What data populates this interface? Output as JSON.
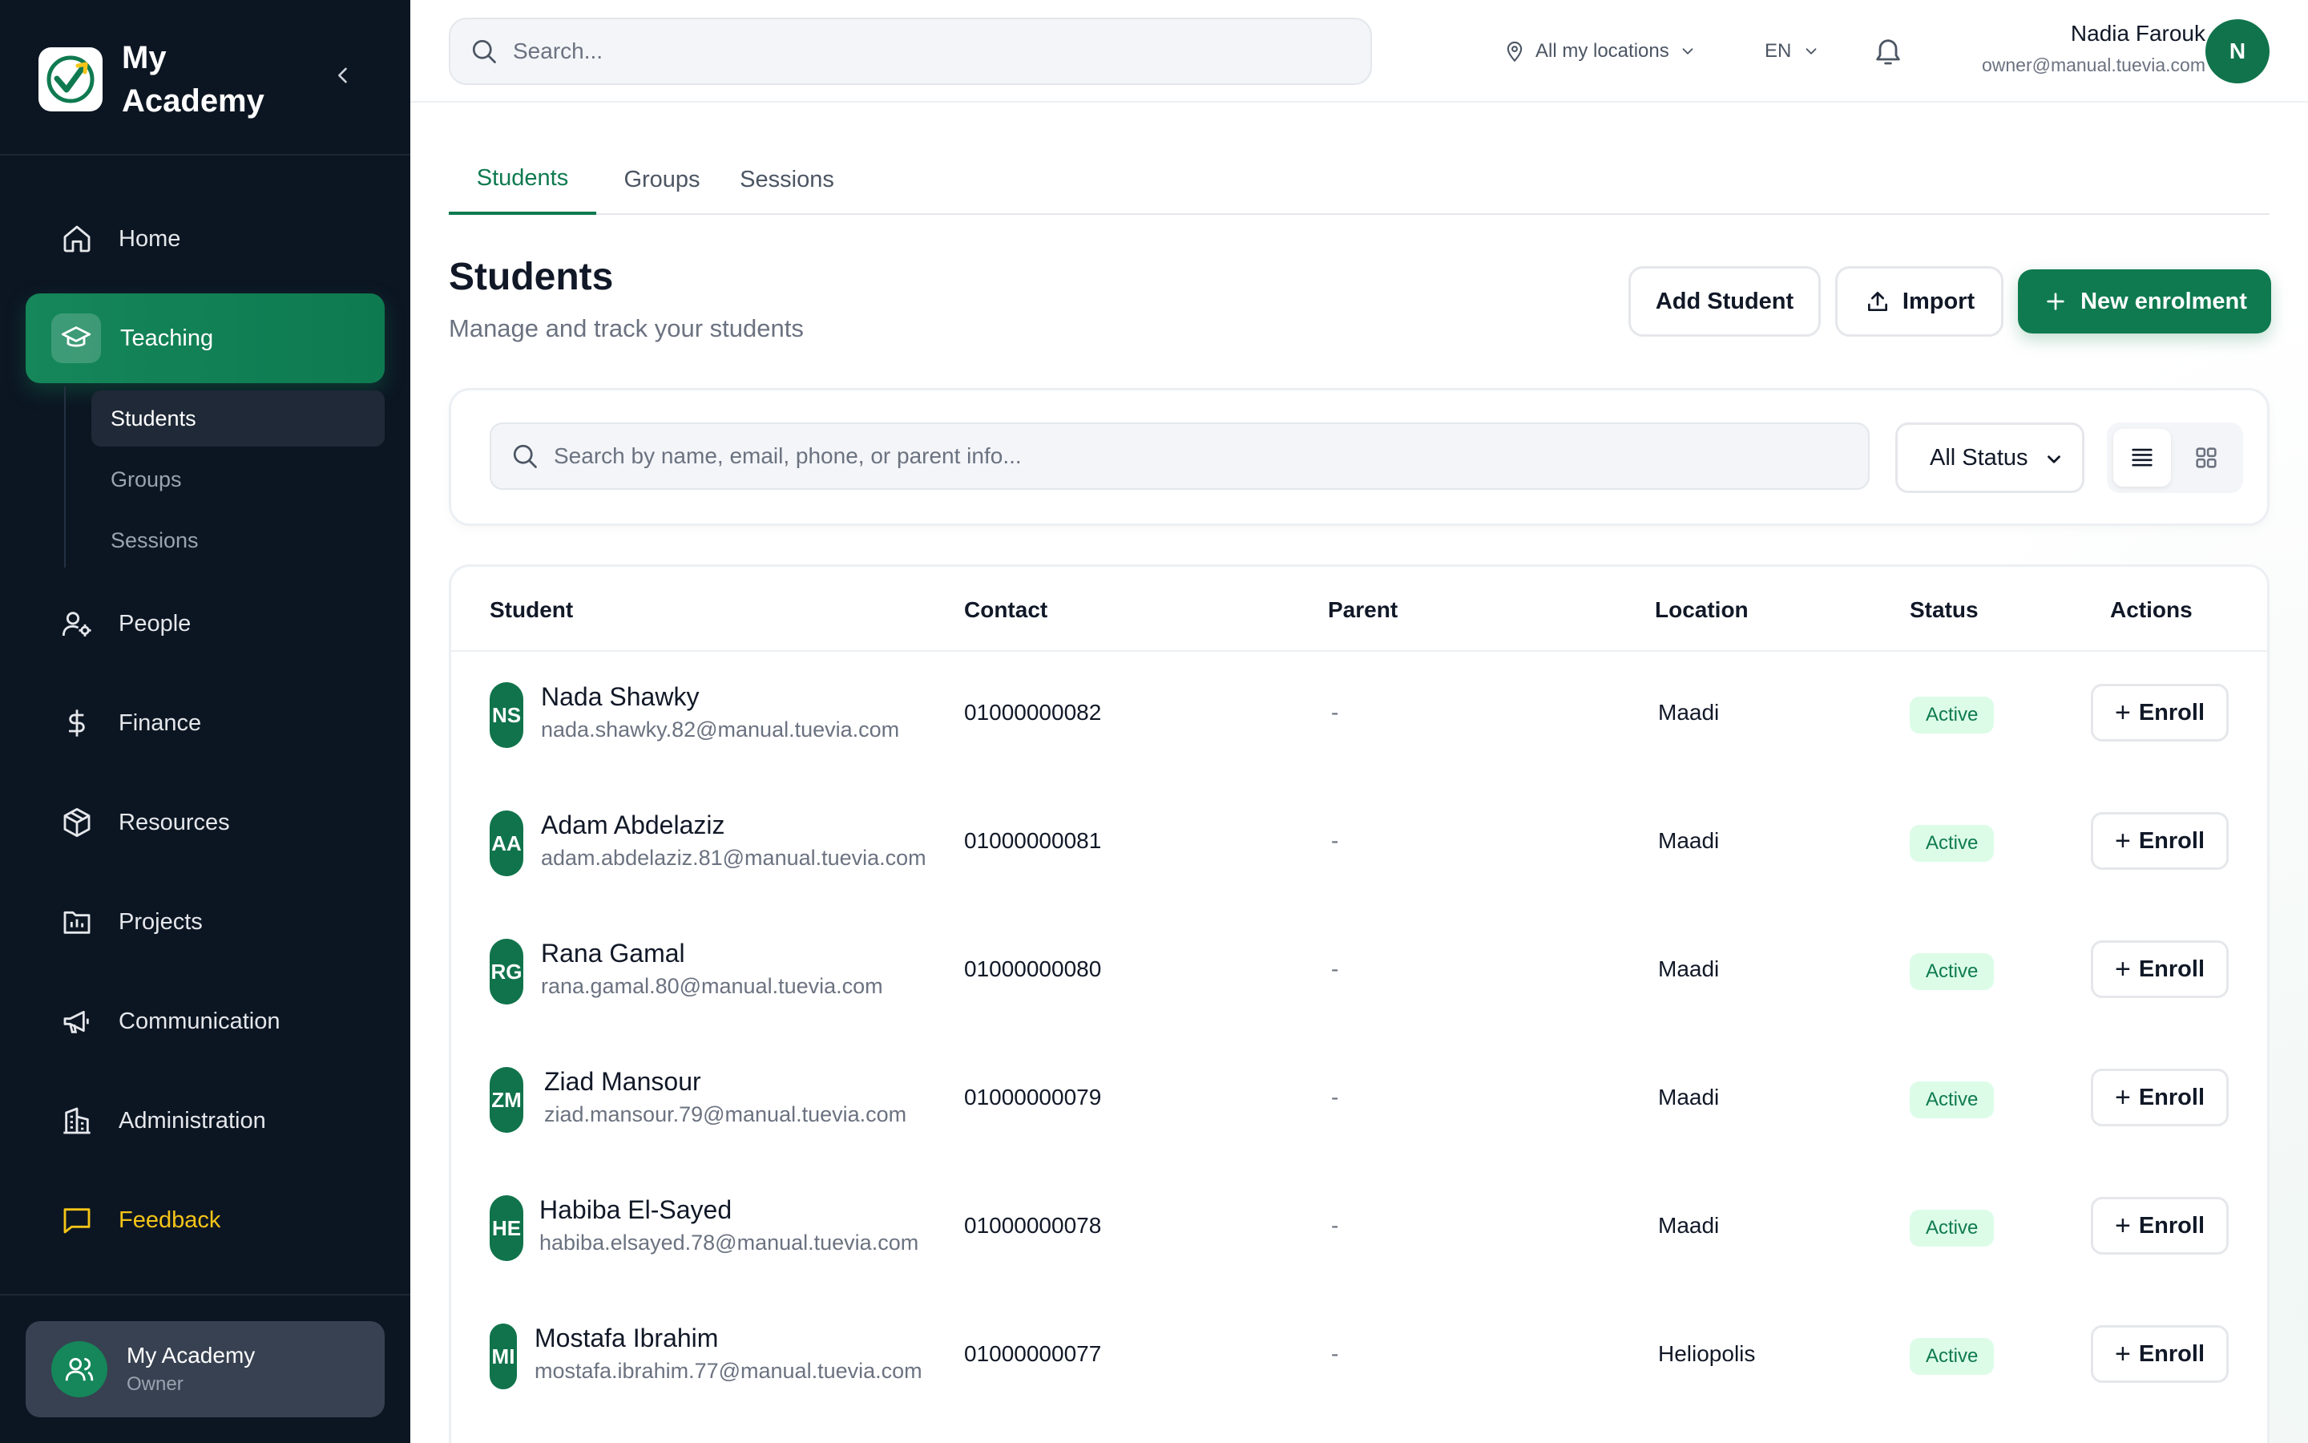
{
  "brand": {
    "name": "My Academy"
  },
  "sidebar": {
    "items": [
      {
        "label": "Home",
        "icon": "home-icon"
      },
      {
        "label": "Teaching",
        "icon": "graduation-cap-icon",
        "active": true
      },
      {
        "label": "People",
        "icon": "user-gear-icon"
      },
      {
        "label": "Finance",
        "icon": "dollar-icon"
      },
      {
        "label": "Resources",
        "icon": "box-icon"
      },
      {
        "label": "Projects",
        "icon": "folder-chart-icon"
      },
      {
        "label": "Communication",
        "icon": "megaphone-icon"
      },
      {
        "label": "Administration",
        "icon": "building-icon"
      },
      {
        "label": "Feedback",
        "icon": "message-square-icon"
      }
    ],
    "subitems": [
      {
        "label": "Students",
        "active": true
      },
      {
        "label": "Groups"
      },
      {
        "label": "Sessions"
      }
    ],
    "account": {
      "name": "My Academy",
      "role": "Owner"
    }
  },
  "topbar": {
    "search_placeholder": "Search...",
    "location": "All my locations",
    "language": "EN",
    "user": {
      "name": "Nadia Farouk",
      "email": "owner@manual.tuevia.com",
      "initial": "N"
    }
  },
  "tabs": [
    {
      "label": "Students",
      "active": true
    },
    {
      "label": "Groups"
    },
    {
      "label": "Sessions"
    }
  ],
  "page": {
    "title": "Students",
    "subtitle": "Manage and track your students",
    "add_student": "Add Student",
    "import": "Import",
    "new_enrolment": "New enrolment"
  },
  "filters": {
    "search_placeholder": "Search by name, email, phone, or parent info...",
    "status": "All Status"
  },
  "table": {
    "columns": {
      "student": "Student",
      "contact": "Contact",
      "parent": "Parent",
      "location": "Location",
      "status": "Status",
      "actions": "Actions"
    },
    "enroll_label": "Enroll",
    "rows": [
      {
        "initials": "NS",
        "name": "Nada Shawky",
        "email": "nada.shawky.82@manual.tuevia.com",
        "contact": "01000000082",
        "parent": "-",
        "location": "Maadi",
        "status": "Active"
      },
      {
        "initials": "AA",
        "name": "Adam Abdelaziz",
        "email": "adam.abdelaziz.81@manual.tuevia.com",
        "contact": "01000000081",
        "parent": "-",
        "location": "Maadi",
        "status": "Active"
      },
      {
        "initials": "RG",
        "name": "Rana Gamal",
        "email": "rana.gamal.80@manual.tuevia.com",
        "contact": "01000000080",
        "parent": "-",
        "location": "Maadi",
        "status": "Active"
      },
      {
        "initials": "ZM",
        "name": "Ziad Mansour",
        "email": "ziad.mansour.79@manual.tuevia.com",
        "contact": "01000000079",
        "parent": "-",
        "location": "Maadi",
        "status": "Active"
      },
      {
        "initials": "HE",
        "name": "Habiba El-Sayed",
        "email": "habiba.elsayed.78@manual.tuevia.com",
        "contact": "01000000078",
        "parent": "-",
        "location": "Maadi",
        "status": "Active"
      },
      {
        "initials": "MI",
        "name": "Mostafa Ibrahim",
        "email": "mostafa.ibrahim.77@manual.tuevia.com",
        "contact": "01000000077",
        "parent": "-",
        "location": "Heliopolis",
        "status": "Active"
      }
    ]
  },
  "colors": {
    "sidebar_bg": "#0c1623",
    "accent": "#0f7a50",
    "active_badge_bg": "#dcfce7",
    "feedback": "#f5c518"
  }
}
